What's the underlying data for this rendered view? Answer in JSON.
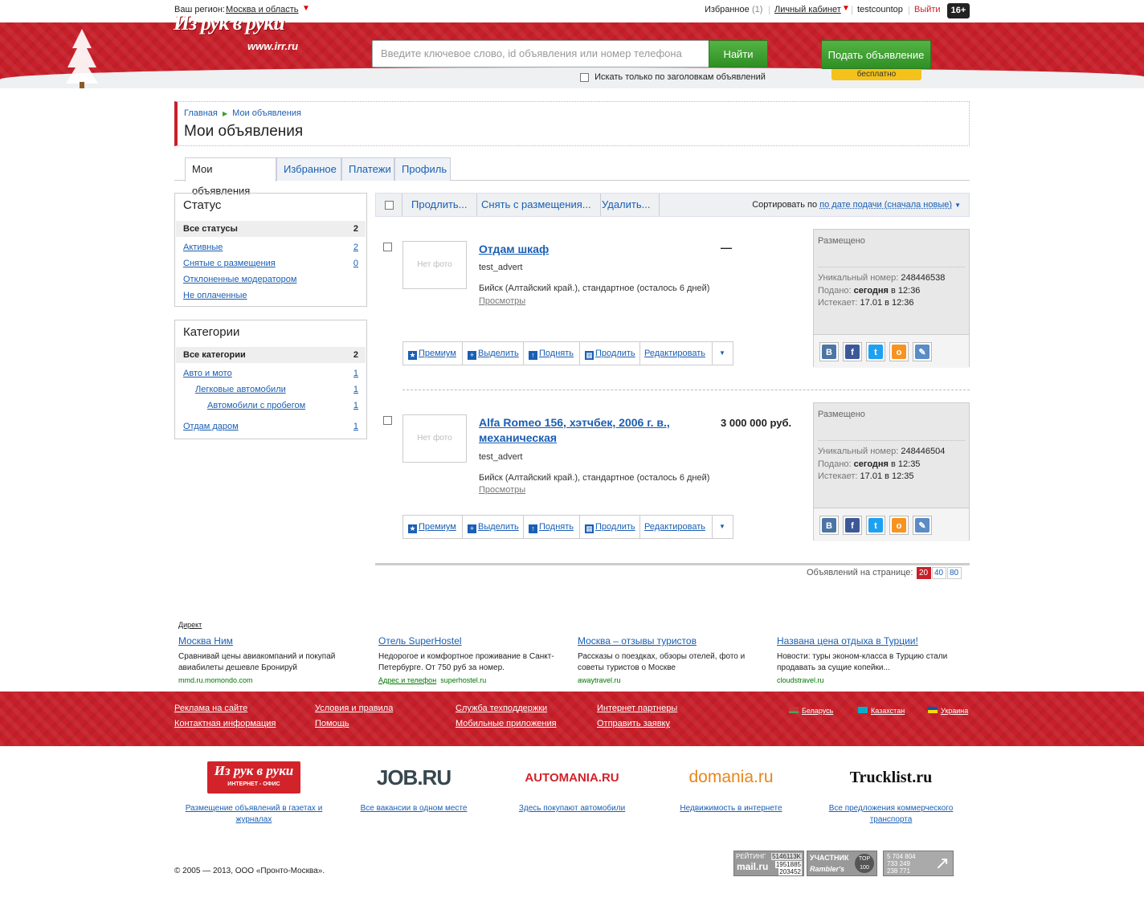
{
  "topbar": {
    "region_label": "Ваш регион:",
    "region_value": "Москва и область",
    "favorites_label": "Избранное",
    "favorites_count": "(1)",
    "cabinet_label": "Личный кабинет",
    "username": "testcountop",
    "logout_label": "Выйти",
    "age_badge": "16+"
  },
  "header": {
    "logo_text": "Из рук в руки",
    "logo_url_text": "www.irr.ru",
    "search_placeholder": "Введите ключевое слово, id объявления или номер телефона",
    "find_label": "Найти",
    "titles_only_label": "Искать только по заголовкам объявлений",
    "post_label": "Подать объявление",
    "free_label": "бесплатно"
  },
  "breadcrumb": {
    "home": "Главная",
    "current": "Мои объявления"
  },
  "page_title": "Мои объявления",
  "tabs": [
    "Мои объявления",
    "Избранное",
    "Платежи",
    "Профиль"
  ],
  "status_box": {
    "title": "Статус",
    "items": [
      {
        "label": "Все статусы",
        "count": "2"
      },
      {
        "label": "Активные",
        "count": "2"
      },
      {
        "label": "Снятые с размещения",
        "count": "0"
      },
      {
        "label": "Отклоненные модератором",
        "count": ""
      },
      {
        "label": "Не оплаченные",
        "count": ""
      }
    ]
  },
  "category_box": {
    "title": "Категории",
    "items": [
      {
        "label": "Все категории",
        "count": "2"
      },
      {
        "label": "Авто и мото",
        "count": "1"
      },
      {
        "label": "Легковые автомобили",
        "count": "1"
      },
      {
        "label": "Автомобили с пробегом",
        "count": "1"
      },
      {
        "label": "Отдам даром",
        "count": "1"
      }
    ]
  },
  "actions": {
    "prolong": "Продлить...",
    "remove": "Снять с размещения...",
    "delete": "Удалить...",
    "sort_label": "Сортировать по",
    "sort_value": "по дате подачи (сначала новые)"
  },
  "ads": [
    {
      "photo": "Нет фото",
      "title": "Отдам шкаф",
      "price": "—",
      "user": "test_advert",
      "location": "Бийск (Алтайский край.), стандартное (осталось 6 дней)",
      "views": "Просмотры",
      "status": "Размещено",
      "uid_label": "Уникальный номер:",
      "uid": "248446538",
      "posted_label": "Подано:",
      "posted_day": "сегодня",
      "posted_time": "в 12:36",
      "expires_label": "Истекает:",
      "expires": "17.01 в 12:36"
    },
    {
      "photo": "Нет фото",
      "title": "Alfa Romeo 156, хэтчбек, 2006 г. в., механическая",
      "price": "3 000 000 руб.",
      "user": "test_advert",
      "location": "Бийск (Алтайский край.), стандартное (осталось 6 дней)",
      "views": "Просмотры",
      "status": "Размещено",
      "uid_label": "Уникальный номер:",
      "uid": "248446504",
      "posted_label": "Подано:",
      "posted_day": "сегодня",
      "posted_time": "в 12:35",
      "expires_label": "Истекает:",
      "expires": "17.01 в 12:35"
    }
  ],
  "ad_toolbar": {
    "premium": "Премиум",
    "highlight": "Выделить",
    "raise": "Поднять",
    "prolong": "Продлить",
    "edit": "Редактировать"
  },
  "social_icons": [
    "vk-icon",
    "facebook-icon",
    "twitter-icon",
    "odnoklassniki-icon",
    "livejournal-icon"
  ],
  "per_page": {
    "label": "Объявлений на странице:",
    "options": [
      "20",
      "40",
      "80"
    ],
    "selected": "20"
  },
  "direct": {
    "label": "Директ",
    "items": [
      {
        "title": "Москва Ним",
        "text": "Сравнивай цены авиакомпаний и покупай авиабилеты дешевле Бронируй",
        "extra": "",
        "url": "mmd.ru.momondo.com"
      },
      {
        "title": "Отель SuperHostel",
        "text": "Недорогое и комфортное проживание в Санкт-Петербурге. От 750 руб за номер.",
        "extra": "Адрес и телефон",
        "url": "superhostel.ru"
      },
      {
        "title": "Москва – отзывы туристов",
        "text": "Рассказы о поездках, обзоры отелей, фото и советы туристов о Москве",
        "extra": "",
        "url": "awaytravel.ru"
      },
      {
        "title": "Названа цена отдыха в Турции!",
        "text": "Новости: туры эконом-класса в Турцию стали продавать за сущие копейки...",
        "extra": "",
        "url": "cloudstravel.ru"
      }
    ]
  },
  "footer_links": [
    [
      "Реклама на сайте",
      "Контактная информация"
    ],
    [
      "Условия и правила",
      "Помощь"
    ],
    [
      "Служба техподдержки",
      "Мобильные приложения"
    ],
    [
      "Интернет партнеры",
      "Отправить заявку"
    ]
  ],
  "countries": [
    "Беларусь",
    "Казахстан",
    "Украина"
  ],
  "partners": [
    {
      "logo": "Из рук в руки",
      "sub": "ИНТЕРНЕТ - ОФИС",
      "caption": "Размещение объявлений в газетах и журналах"
    },
    {
      "logo": "JOB.RU",
      "caption": "Все вакансии в одном месте"
    },
    {
      "logo": "AUTOMANIA.RU",
      "caption": "Здесь покупают автомобили"
    },
    {
      "logo": "domania.ru",
      "caption": "Недвижимость в интернете"
    },
    {
      "logo": "Trucklist.ru",
      "caption": "Все предложения коммерческого транспорта"
    }
  ],
  "copyright": "© 2005 — 2013, ООО «Пронто-Москва».",
  "counters": {
    "mail": {
      "label": "РЕЙТИНГ",
      "brand": "mail.ru",
      "v1": "5146113K",
      "v2": "1951885",
      "v3": "203452"
    },
    "rambler": {
      "label": "УЧАСТНИК",
      "brand": "Rambler's",
      "top": "TOP 100"
    },
    "li": {
      "v1": "5 704 804",
      "v2": "733 249",
      "v3": "238 771"
    }
  },
  "colors": {
    "brand_red": "#c8202a",
    "link_blue": "#1a5fb4",
    "button_green": "#3a9e2e",
    "badge_yellow": "#f4c21a"
  }
}
